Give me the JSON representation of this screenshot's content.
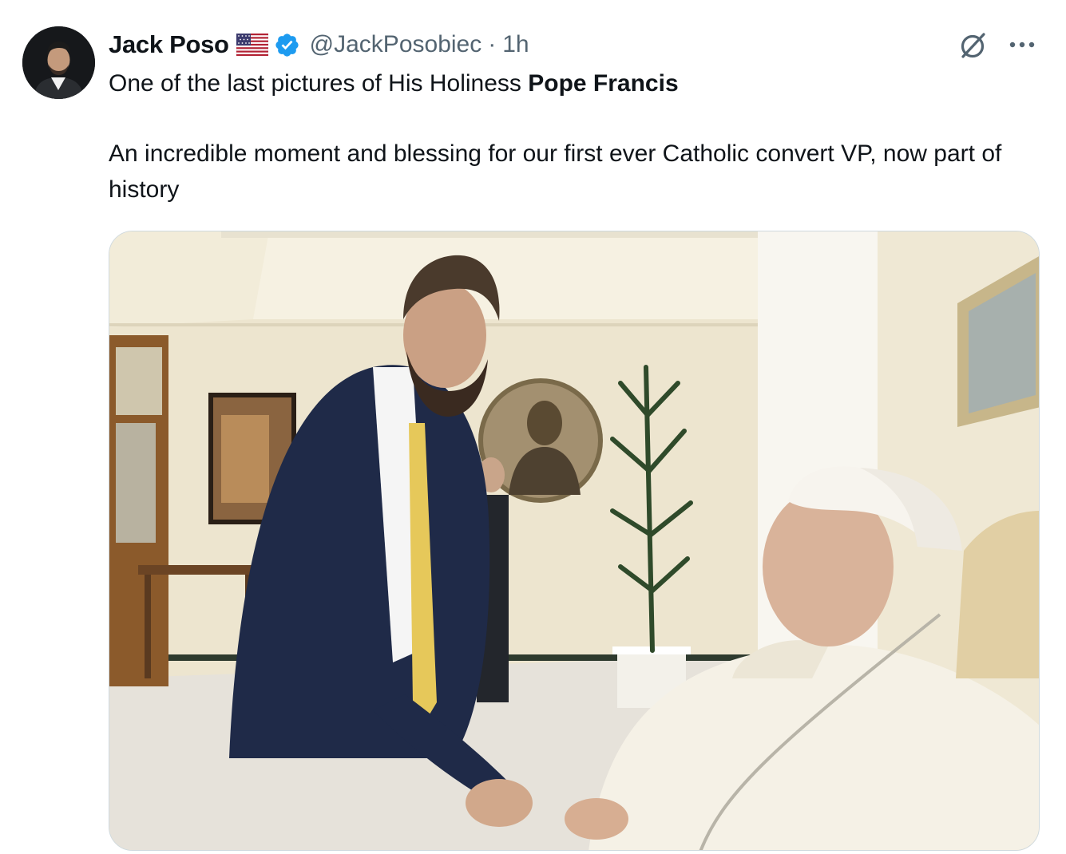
{
  "tweet": {
    "author": {
      "display_name": "Jack Poso",
      "handle": "@JackPosobiec",
      "flag": "us-flag-emoji",
      "verified": true,
      "verified_color": "#1d9bf0"
    },
    "separator": "·",
    "time": "1h",
    "text": {
      "line1_prefix": "One of the last pictures of His Holiness ",
      "line1_bold": "Pope Francis",
      "paragraph2": "An incredible moment and blessing for our first ever Catholic convert VP, now part of history"
    },
    "media": {
      "type": "photo"
    },
    "actions": {
      "grok_icon": "grok-icon",
      "more_icon": "more-icon"
    }
  },
  "colors": {
    "text_primary": "#0f1419",
    "text_secondary": "#536471",
    "border": "#cfd9de",
    "accent": "#1d9bf0"
  }
}
